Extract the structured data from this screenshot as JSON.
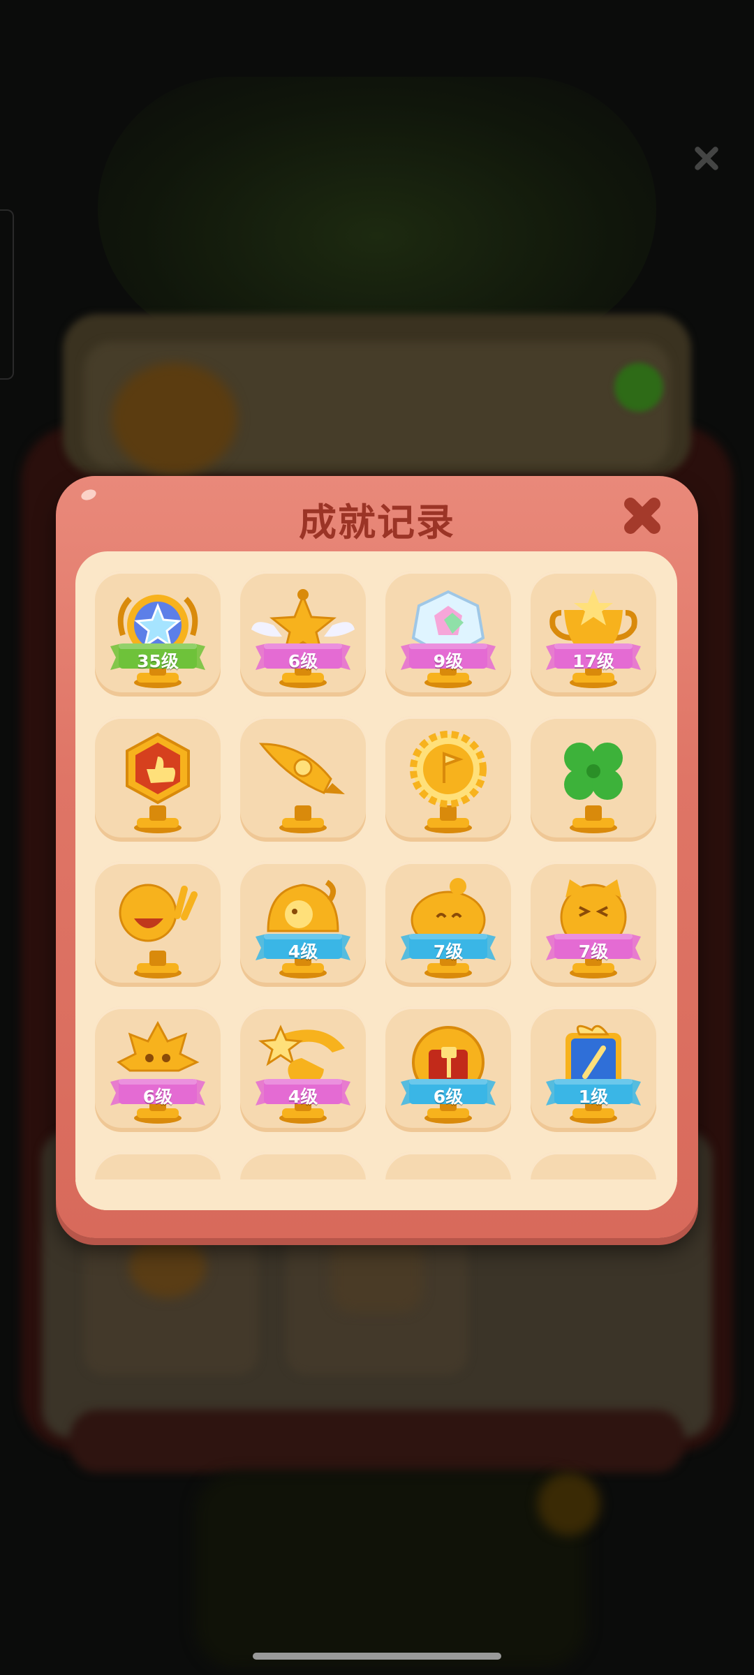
{
  "dialog": {
    "title": "成就记录",
    "close_icon": "close-icon"
  },
  "achievements": [
    {
      "icon": "rainbow-star-medal-icon",
      "level": "35级",
      "ribbon": "#6ec23a"
    },
    {
      "icon": "winged-star-trophy-icon",
      "level": "6级",
      "ribbon": "#e46bd3"
    },
    {
      "icon": "crystal-gem-trophy-icon",
      "level": "9级",
      "ribbon": "#e46bd3"
    },
    {
      "icon": "gold-stars-cup-icon",
      "level": "17级",
      "ribbon": "#e46bd3"
    },
    {
      "icon": "thumbs-up-hexagon-trophy-icon",
      "level": "",
      "ribbon": ""
    },
    {
      "icon": "rocket-trophy-icon",
      "level": "",
      "ribbon": ""
    },
    {
      "icon": "sun-flag-trophy-icon",
      "level": "",
      "ribbon": ""
    },
    {
      "icon": "four-leaf-clover-trophy-icon",
      "level": "",
      "ribbon": ""
    },
    {
      "icon": "laughing-face-peace-trophy-icon",
      "level": "",
      "ribbon": ""
    },
    {
      "icon": "chick-trophy-icon",
      "level": "4级",
      "ribbon": "#3ab6e6"
    },
    {
      "icon": "smiling-blob-trophy-icon",
      "level": "7级",
      "ribbon": "#3ab6e6"
    },
    {
      "icon": "cat-face-trophy-icon",
      "level": "7级",
      "ribbon": "#e46bd3"
    },
    {
      "icon": "spiky-monster-trophy-icon",
      "level": "6级",
      "ribbon": "#e46bd3"
    },
    {
      "icon": "shooting-star-hand-trophy-icon",
      "level": "4级",
      "ribbon": "#e46bd3"
    },
    {
      "icon": "hammer-emblem-trophy-icon",
      "level": "6级",
      "ribbon": "#3ab6e6"
    },
    {
      "icon": "blue-card-bow-trophy-icon",
      "level": "1级",
      "ribbon": "#3ab6e6"
    }
  ]
}
